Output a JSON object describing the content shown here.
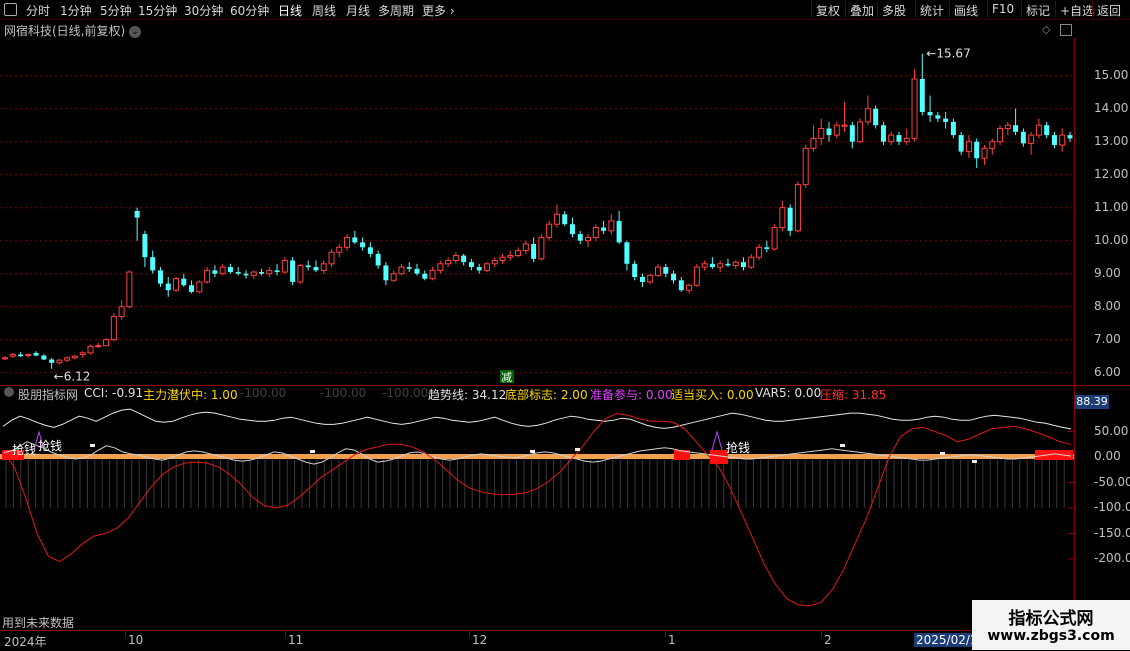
{
  "toolbar": {
    "periods": [
      "分时",
      "1分钟",
      "5分钟",
      "15分钟",
      "30分钟",
      "60分钟",
      "日线",
      "周线",
      "月线",
      "多周期",
      "更多"
    ],
    "active_period": "日线",
    "right_buttons": [
      "复权",
      "叠加",
      "多股",
      "统计",
      "画线",
      "F10",
      "标记",
      "+自选",
      "返回"
    ]
  },
  "stock": {
    "title": "网宿科技(日线,前复权)",
    "high_label": "15.67",
    "low_label": "6.12",
    "event_mark": "减"
  },
  "price_axis": [
    "15.00",
    "14.00",
    "13.00",
    "12.00",
    "11.00",
    "10.00",
    "9.00",
    "8.00",
    "7.00",
    "6.00"
  ],
  "indicator": {
    "name": "股朋指标网",
    "items": [
      {
        "label": "CCI: -0.91",
        "color": "#e0e0e0"
      },
      {
        "label": "主力潜伏中: 1.00",
        "color": "#ffd700"
      },
      {
        "label": "-100.00",
        "color": "#404040"
      },
      {
        "label": "-100.00",
        "color": "#404040"
      },
      {
        "label": "-100.00",
        "color": "#404040"
      },
      {
        "label": "趋势线: 34.12",
        "color": "#e0e0e0"
      },
      {
        "label": "底部标志: 2.00",
        "color": "#ffd700"
      },
      {
        "label": "准备参与: 0.00",
        "color": "#e040ff"
      },
      {
        "label": "适当买入: 0.00",
        "color": "#ffd700"
      },
      {
        "label": "VAR5: 0.00",
        "color": "#e0e0e0"
      },
      {
        "label": "压缩: 31.85",
        "color": "#ff3030"
      }
    ],
    "current_value": "88.39",
    "axis": [
      "50.00",
      "0.00",
      "-50.00",
      "-100.0",
      "-150.0",
      "-200.0"
    ],
    "signal_label": "抢钱"
  },
  "footer": {
    "future_note": "用到未来数据",
    "dates": [
      "2024年",
      "10",
      "11",
      "12",
      "1",
      "2",
      "2025/02/19"
    ]
  },
  "watermark": {
    "title": "指标公式网",
    "url": "www.zbgs3.com"
  },
  "chart_data": {
    "type": "candlestick",
    "y_range": [
      5.9,
      15.9
    ],
    "ohlc": [
      [
        6.45,
        6.5,
        6.38,
        6.45
      ],
      [
        6.5,
        6.6,
        6.45,
        6.55
      ],
      [
        6.55,
        6.62,
        6.48,
        6.5
      ],
      [
        6.52,
        6.58,
        6.46,
        6.55
      ],
      [
        6.6,
        6.65,
        6.5,
        6.52
      ],
      [
        6.52,
        6.56,
        6.38,
        6.4
      ],
      [
        6.4,
        6.45,
        6.12,
        6.3
      ],
      [
        6.3,
        6.42,
        6.25,
        6.38
      ],
      [
        6.38,
        6.5,
        6.32,
        6.45
      ],
      [
        6.45,
        6.55,
        6.4,
        6.5
      ],
      [
        6.55,
        6.65,
        6.45,
        6.6
      ],
      [
        6.6,
        6.85,
        6.55,
        6.8
      ],
      [
        6.8,
        6.9,
        6.75,
        6.82
      ],
      [
        6.82,
        7.05,
        6.8,
        7.0
      ],
      [
        7.0,
        7.8,
        6.95,
        7.7
      ],
      [
        7.7,
        8.2,
        7.6,
        8.0
      ],
      [
        8.0,
        9.1,
        7.95,
        9.05
      ],
      [
        10.9,
        11.0,
        10.0,
        10.7
      ],
      [
        10.2,
        10.3,
        9.2,
        9.5
      ],
      [
        9.5,
        9.7,
        9.0,
        9.1
      ],
      [
        9.1,
        9.2,
        8.6,
        8.7
      ],
      [
        8.7,
        8.9,
        8.3,
        8.5
      ],
      [
        8.5,
        8.9,
        8.45,
        8.85
      ],
      [
        8.85,
        9.0,
        8.6,
        8.65
      ],
      [
        8.65,
        8.8,
        8.4,
        8.45
      ],
      [
        8.45,
        8.8,
        8.4,
        8.75
      ],
      [
        8.75,
        9.2,
        8.7,
        9.1
      ],
      [
        9.1,
        9.25,
        8.9,
        9.0
      ],
      [
        9.0,
        9.3,
        8.95,
        9.2
      ],
      [
        9.2,
        9.3,
        9.0,
        9.05
      ],
      [
        9.05,
        9.2,
        8.95,
        9.0
      ],
      [
        9.0,
        9.1,
        8.85,
        8.95
      ],
      [
        8.95,
        9.1,
        8.85,
        9.05
      ],
      [
        9.05,
        9.15,
        8.95,
        9.0
      ],
      [
        9.0,
        9.2,
        8.9,
        9.1
      ],
      [
        9.1,
        9.3,
        8.95,
        9.05
      ],
      [
        9.05,
        9.5,
        9.0,
        9.4
      ],
      [
        9.4,
        9.5,
        8.65,
        8.75
      ],
      [
        8.75,
        9.3,
        8.7,
        9.25
      ],
      [
        9.25,
        9.4,
        9.1,
        9.2
      ],
      [
        9.2,
        9.4,
        9.05,
        9.1
      ],
      [
        9.1,
        9.4,
        9.0,
        9.3
      ],
      [
        9.3,
        9.75,
        9.2,
        9.65
      ],
      [
        9.65,
        9.9,
        9.5,
        9.8
      ],
      [
        9.8,
        10.2,
        9.7,
        10.1
      ],
      [
        10.1,
        10.3,
        9.9,
        9.95
      ],
      [
        9.95,
        10.1,
        9.7,
        9.8
      ],
      [
        9.8,
        9.95,
        9.5,
        9.6
      ],
      [
        9.6,
        9.7,
        9.15,
        9.25
      ],
      [
        9.25,
        9.35,
        8.65,
        8.8
      ],
      [
        8.8,
        9.1,
        8.75,
        9.0
      ],
      [
        9.0,
        9.3,
        8.95,
        9.2
      ],
      [
        9.2,
        9.35,
        9.05,
        9.15
      ],
      [
        9.15,
        9.3,
        8.95,
        9.0
      ],
      [
        9.0,
        9.1,
        8.8,
        8.85
      ],
      [
        8.85,
        9.2,
        8.8,
        9.1
      ],
      [
        9.1,
        9.4,
        9.0,
        9.3
      ],
      [
        9.3,
        9.5,
        9.2,
        9.4
      ],
      [
        9.4,
        9.65,
        9.3,
        9.55
      ],
      [
        9.55,
        9.6,
        9.25,
        9.35
      ],
      [
        9.35,
        9.45,
        9.1,
        9.2
      ],
      [
        9.2,
        9.3,
        9.0,
        9.1
      ],
      [
        9.1,
        9.35,
        9.05,
        9.3
      ],
      [
        9.3,
        9.5,
        9.2,
        9.4
      ],
      [
        9.4,
        9.6,
        9.3,
        9.5
      ],
      [
        9.5,
        9.7,
        9.4,
        9.55
      ],
      [
        9.55,
        9.8,
        9.5,
        9.7
      ],
      [
        9.7,
        10.0,
        9.6,
        9.9
      ],
      [
        9.9,
        10.1,
        9.35,
        9.45
      ],
      [
        9.45,
        10.2,
        9.4,
        10.1
      ],
      [
        10.1,
        10.6,
        10.0,
        10.5
      ],
      [
        10.5,
        11.1,
        10.4,
        10.8
      ],
      [
        10.8,
        10.9,
        10.45,
        10.5
      ],
      [
        10.5,
        10.7,
        10.1,
        10.2
      ],
      [
        10.2,
        10.3,
        9.9,
        10.0
      ],
      [
        10.0,
        10.2,
        9.8,
        10.1
      ],
      [
        10.1,
        10.5,
        10.0,
        10.4
      ],
      [
        10.4,
        10.6,
        10.2,
        10.3
      ],
      [
        10.3,
        10.8,
        10.2,
        10.6
      ],
      [
        10.6,
        10.9,
        9.9,
        9.95
      ],
      [
        9.95,
        10.0,
        9.1,
        9.3
      ],
      [
        9.3,
        9.4,
        8.8,
        8.9
      ],
      [
        8.9,
        9.0,
        8.6,
        8.75
      ],
      [
        8.75,
        9.0,
        8.7,
        8.95
      ],
      [
        8.95,
        9.3,
        8.9,
        9.2
      ],
      [
        9.2,
        9.3,
        8.9,
        9.0
      ],
      [
        9.0,
        9.1,
        8.7,
        8.8
      ],
      [
        8.8,
        8.9,
        8.45,
        8.5
      ],
      [
        8.5,
        8.7,
        8.4,
        8.65
      ],
      [
        8.65,
        9.3,
        8.6,
        9.2
      ],
      [
        9.2,
        9.4,
        9.1,
        9.3
      ],
      [
        9.3,
        9.5,
        9.15,
        9.2
      ],
      [
        9.2,
        9.4,
        9.05,
        9.3
      ],
      [
        9.3,
        9.45,
        9.2,
        9.25
      ],
      [
        9.25,
        9.4,
        9.15,
        9.35
      ],
      [
        9.35,
        9.5,
        9.1,
        9.2
      ],
      [
        9.2,
        9.6,
        9.15,
        9.5
      ],
      [
        9.5,
        9.9,
        9.4,
        9.8
      ],
      [
        9.8,
        10.0,
        9.65,
        9.75
      ],
      [
        9.75,
        10.5,
        9.7,
        10.4
      ],
      [
        10.4,
        11.2,
        10.3,
        11.0
      ],
      [
        11.0,
        11.1,
        10.15,
        10.3
      ],
      [
        10.3,
        11.8,
        10.25,
        11.7
      ],
      [
        11.7,
        12.9,
        11.6,
        12.8
      ],
      [
        12.8,
        13.5,
        12.7,
        13.1
      ],
      [
        13.1,
        13.7,
        12.9,
        13.4
      ],
      [
        13.4,
        13.6,
        13.0,
        13.2
      ],
      [
        13.2,
        13.6,
        13.1,
        13.5
      ],
      [
        13.5,
        14.2,
        13.3,
        13.5
      ],
      [
        13.5,
        13.6,
        12.8,
        13.0
      ],
      [
        13.0,
        13.7,
        12.95,
        13.6
      ],
      [
        13.6,
        14.4,
        13.5,
        14.0
      ],
      [
        14.0,
        14.1,
        13.4,
        13.5
      ],
      [
        13.5,
        13.6,
        12.9,
        13.0
      ],
      [
        13.0,
        13.3,
        12.9,
        13.2
      ],
      [
        13.2,
        13.3,
        12.9,
        13.0
      ],
      [
        13.0,
        13.4,
        12.9,
        13.1
      ],
      [
        13.1,
        15.2,
        13.0,
        14.9
      ],
      [
        14.9,
        15.67,
        13.8,
        13.9
      ],
      [
        13.9,
        14.4,
        13.6,
        13.8
      ],
      [
        13.8,
        13.9,
        13.6,
        13.7
      ],
      [
        13.7,
        13.9,
        13.4,
        13.6
      ],
      [
        13.6,
        13.7,
        13.1,
        13.2
      ],
      [
        13.2,
        13.3,
        12.6,
        12.7
      ],
      [
        12.7,
        13.2,
        12.5,
        13.0
      ],
      [
        13.0,
        13.1,
        12.2,
        12.5
      ],
      [
        12.5,
        12.9,
        12.3,
        12.8
      ],
      [
        12.8,
        13.1,
        12.6,
        13.0
      ],
      [
        13.0,
        13.5,
        12.9,
        13.4
      ],
      [
        13.4,
        13.6,
        13.2,
        13.5
      ],
      [
        13.5,
        14.0,
        13.2,
        13.3
      ],
      [
        13.3,
        13.4,
        12.85,
        12.95
      ],
      [
        12.95,
        13.3,
        12.6,
        13.2
      ],
      [
        13.2,
        13.7,
        13.1,
        13.5
      ],
      [
        13.5,
        13.6,
        13.1,
        13.2
      ],
      [
        13.2,
        13.3,
        12.8,
        12.9
      ],
      [
        12.9,
        13.4,
        12.7,
        13.2
      ],
      [
        13.2,
        13.3,
        13.0,
        13.1
      ]
    ],
    "cci_white_1": [
      60,
      72,
      80,
      75,
      68,
      62,
      58,
      64,
      72,
      80,
      76,
      70,
      78,
      86,
      92,
      94,
      86,
      78,
      70,
      68,
      70,
      76,
      82,
      86,
      88,
      86,
      82,
      78,
      74,
      72,
      70,
      70,
      72,
      76,
      78,
      74,
      70,
      66,
      64,
      64,
      66,
      70,
      74,
      78,
      74,
      70,
      66,
      64,
      66,
      70,
      74,
      78,
      76,
      72,
      70,
      68,
      70,
      74,
      78,
      72,
      66,
      62,
      60,
      62,
      66,
      72,
      76,
      80,
      78,
      74,
      72,
      70,
      72,
      76,
      74,
      68,
      62,
      58,
      56,
      58,
      62,
      66,
      70,
      74,
      78,
      82,
      86,
      84,
      80,
      76,
      72,
      70,
      70,
      72,
      74,
      76,
      78,
      80,
      82,
      84,
      86,
      86,
      84,
      82,
      78,
      74,
      72,
      72,
      74,
      78,
      80,
      78,
      74,
      72,
      72,
      76,
      80,
      82,
      80,
      78,
      76,
      72,
      68,
      66,
      62,
      58,
      55
    ],
    "cci_white_2": [
      8,
      12,
      20,
      30,
      24,
      18,
      10,
      4,
      0,
      -4,
      -2,
      4,
      14,
      22,
      18,
      10,
      6,
      4,
      0,
      -4,
      -6,
      -2,
      4,
      10,
      12,
      10,
      6,
      2,
      -2,
      -6,
      -8,
      -6,
      -2,
      4,
      10,
      8,
      2,
      -4,
      -10,
      -14,
      -10,
      -2,
      8,
      16,
      14,
      6,
      -4,
      -10,
      -8,
      -4,
      2,
      8,
      10,
      6,
      0,
      -4,
      -6,
      -4,
      0,
      4,
      6,
      4,
      2,
      0,
      -2,
      0,
      4,
      8,
      10,
      8,
      4,
      0,
      -4,
      -8,
      -10,
      -8,
      -4,
      0,
      4,
      8,
      12,
      14,
      16,
      18,
      16,
      12,
      10,
      8,
      6,
      4,
      2,
      0,
      -2,
      -4,
      -4,
      -2,
      0,
      2,
      4,
      6,
      8,
      10,
      12,
      14,
      16,
      14,
      12,
      10,
      8,
      6,
      4,
      2,
      0,
      -2,
      -4,
      -6,
      -6,
      -4,
      -2,
      0,
      2,
      4,
      4,
      2,
      0,
      -2,
      -4,
      -4,
      -2,
      0,
      2,
      4,
      6,
      4,
      2
    ],
    "cci_red": [
      10,
      -20,
      -80,
      -150,
      -195,
      -205,
      -190,
      -170,
      -155,
      -150,
      -140,
      -120,
      -90,
      -60,
      -35,
      -20,
      -12,
      -10,
      -12,
      -20,
      -35,
      -55,
      -80,
      -95,
      -100,
      -95,
      -80,
      -60,
      -40,
      -25,
      -10,
      5,
      15,
      20,
      25,
      25,
      20,
      10,
      -5,
      -25,
      -45,
      -60,
      -68,
      -72,
      -74,
      -73,
      -70,
      -62,
      -48,
      -30,
      -5,
      20,
      50,
      75,
      85,
      82,
      75,
      70,
      70,
      68,
      55,
      30,
      5,
      -20,
      -60,
      -110,
      -160,
      -210,
      -250,
      -278,
      -290,
      -292,
      -285,
      -260,
      -220,
      -170,
      -120,
      -60,
      0,
      40,
      55,
      58,
      50,
      42,
      30,
      35,
      45,
      55,
      58,
      60,
      55,
      48,
      40,
      30,
      25
    ]
  }
}
